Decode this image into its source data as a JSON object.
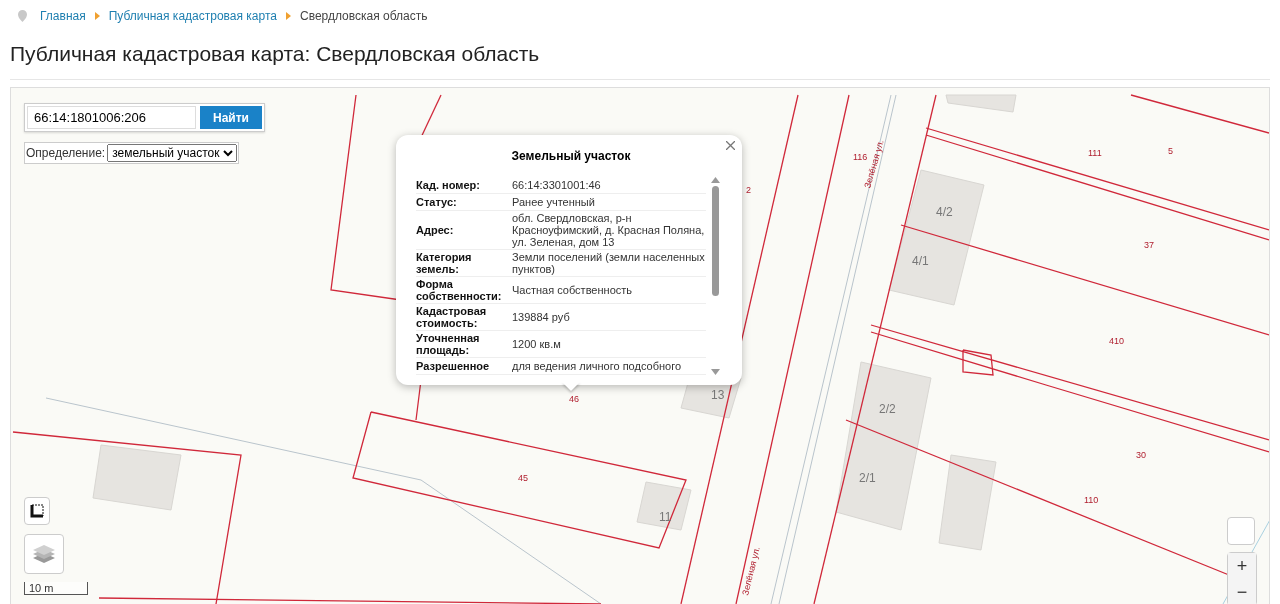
{
  "breadcrumb": [
    {
      "label": "Главная",
      "kind": "link"
    },
    {
      "label": "Публичная кадастровая карта",
      "kind": "link"
    },
    {
      "label": "Свердловская область",
      "kind": "current"
    }
  ],
  "title": "Публичная кадастровая карта: Свердловская область",
  "search": {
    "value": "66:14:1801006:206",
    "button": "Найти"
  },
  "definition": {
    "label": "Определение:",
    "value": "земельный участок"
  },
  "popup": {
    "title": "Земельный участок",
    "rows": [
      {
        "label": "Кад. номер:",
        "value": "66:14:3301001:46"
      },
      {
        "label": "Статус:",
        "value": "Ранее учтенный"
      },
      {
        "label": "Адрес:",
        "value": "обл. Свердловская, р-н Красноуфимский, д. Красная Поляна, ул. Зеленая, дом 13"
      },
      {
        "label": "Категория земель:",
        "value": "Земли поселений (земли населенных пунктов)"
      },
      {
        "label": "Форма собственности:",
        "value": "Частная собственность"
      },
      {
        "label": "Кадастровая стоимость:",
        "value": "139884 руб"
      },
      {
        "label": "Уточненная площадь:",
        "value": "1200 кв.м"
      },
      {
        "label": "Разрешенное",
        "value": "для ведения личного подсобного"
      }
    ]
  },
  "map": {
    "parcel_labels": [
      "116",
      "111",
      "5",
      "37",
      "410",
      "30",
      "110",
      "46",
      "45",
      "2"
    ],
    "building_labels": [
      "4/2",
      "4/1",
      "13",
      "2/2",
      "2/1",
      "11"
    ],
    "street_labels": [
      "Зелёная ул.",
      "Зелёная ул."
    ]
  },
  "scale": {
    "label": "10 m"
  },
  "zoom": {
    "in": "+",
    "out": "−"
  }
}
